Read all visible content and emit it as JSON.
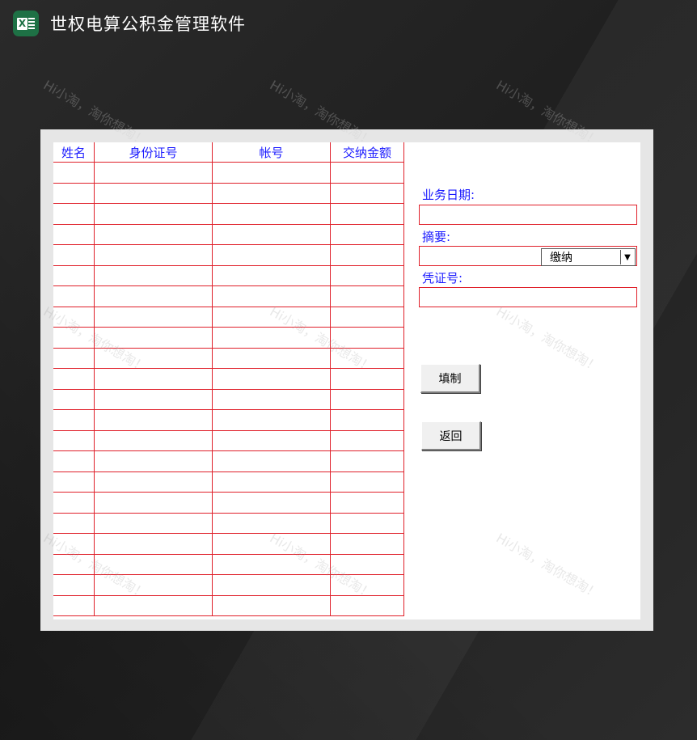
{
  "app": {
    "title": "世权电算公积金管理软件",
    "icon": "excel-icon",
    "icon_letter": "X"
  },
  "colors": {
    "grid_line": "#e0202a",
    "label_text": "#1a1aff",
    "frame": "#e6e6e6",
    "background": "#1f1f1f"
  },
  "table": {
    "headers": [
      "姓名",
      "身份证号",
      "帐号",
      "交纳金额"
    ],
    "row_count": 22
  },
  "form": {
    "business_date_label": "业务日期:",
    "business_date_value": "",
    "summary_label": "摘要:",
    "summary_value": "",
    "summary_select_value": "缴纳",
    "voucher_label": "凭证号:",
    "voucher_value": ""
  },
  "buttons": {
    "fill": "填制",
    "back": "返回"
  },
  "watermark": "Hi小淘，淘你想淘！"
}
